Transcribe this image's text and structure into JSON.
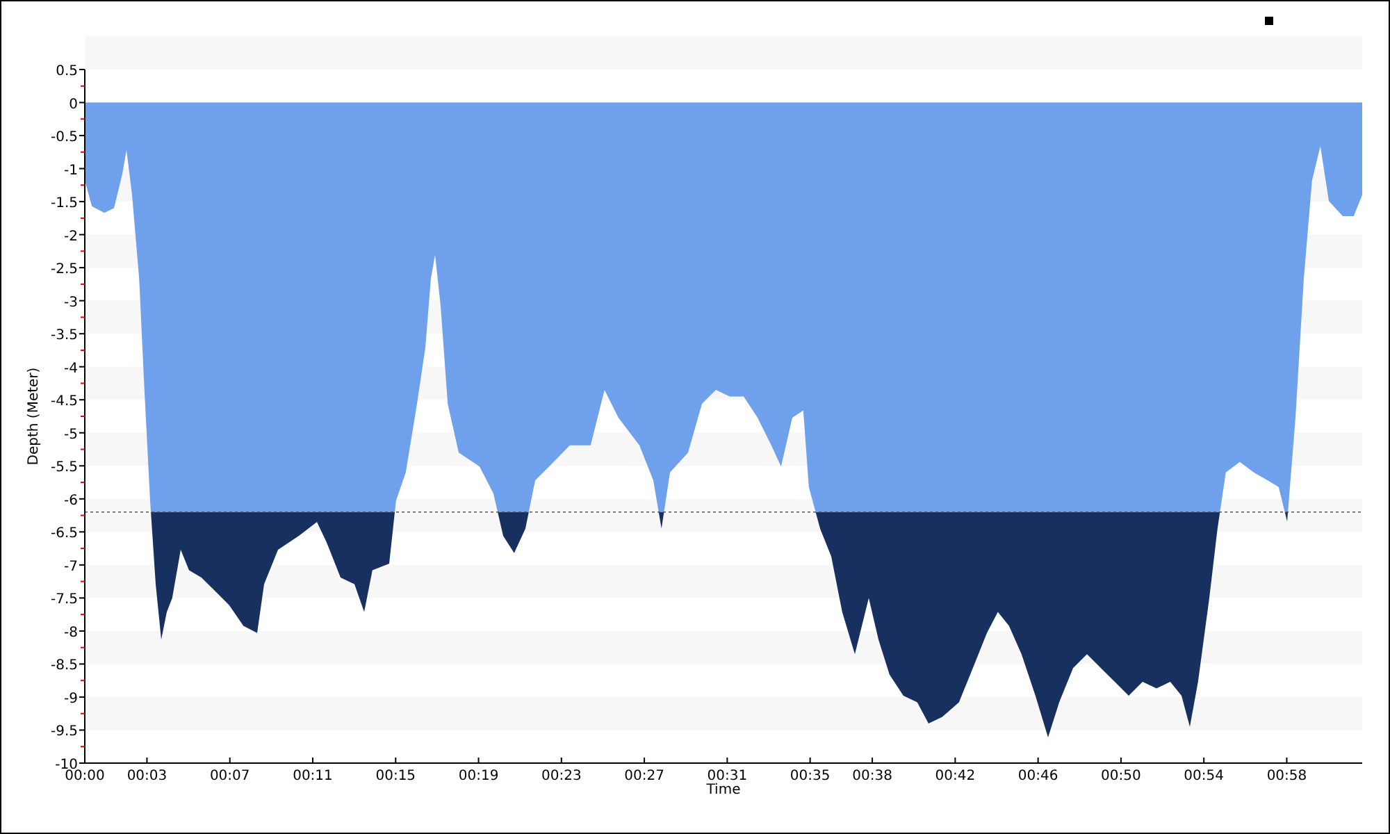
{
  "chart_data": {
    "type": "area",
    "xlabel": "Time",
    "ylabel": "Depth (Meter)",
    "x": [
      0,
      0.34,
      0.94,
      1.41,
      1.81,
      2.01,
      2.28,
      2.62,
      2.88,
      3.15,
      3.42,
      3.69,
      3.96,
      4.22,
      4.63,
      5.03,
      5.63,
      6.3,
      6.97,
      7.65,
      8.32,
      8.65,
      9.32,
      10.33,
      11.2,
      11.67,
      12.34,
      13.01,
      13.48,
      13.88,
      14.69,
      15.02,
      15.49,
      16.03,
      16.43,
      16.7,
      16.9,
      17.17,
      17.51,
      18.04,
      19.05,
      19.72,
      20.19,
      20.72,
      21.26,
      21.73,
      22.4,
      23.41,
      24.41,
      25.08,
      25.75,
      26.76,
      27.43,
      27.83,
      28.24,
      29.11,
      29.78,
      30.45,
      31.12,
      31.79,
      32.46,
      33.13,
      33.6,
      34.14,
      34.67,
      34.94,
      35.48,
      36.02,
      36.55,
      37.16,
      37.83,
      38.3,
      38.83,
      39.5,
      40.17,
      40.71,
      41.38,
      42.18,
      42.85,
      43.53,
      44.06,
      44.6,
      45.2,
      45.87,
      46.48,
      47.02,
      47.69,
      48.36,
      49.03,
      49.7,
      50.37,
      51.04,
      51.71,
      52.38,
      52.92,
      53.32,
      53.72,
      54.26,
      54.66,
      55.06,
      55.73,
      56.41,
      57.08,
      57.61,
      58.02,
      58.42,
      58.82,
      59.22,
      59.62,
      60.03,
      60.7,
      61.23,
      61.64
    ],
    "series": [
      {
        "color": "#6fa0ec",
        "values": [
          -1.18,
          -1.57,
          -1.67,
          -1.6,
          -1.08,
          -0.72,
          -1.4,
          -2.66,
          -4.35,
          -6.03,
          -7.29,
          -8.13,
          -7.71,
          -7.5,
          -6.77,
          -7.08,
          -7.19,
          -7.4,
          -7.61,
          -7.92,
          -8.03,
          -7.29,
          -6.77,
          -6.56,
          -6.35,
          -6.66,
          -7.19,
          -7.29,
          -7.71,
          -7.08,
          -6.98,
          -6.03,
          -5.6,
          -4.56,
          -3.71,
          -2.66,
          -2.3,
          -3.08,
          -4.56,
          -5.3,
          -5.51,
          -5.92,
          -6.56,
          -6.82,
          -6.45,
          -5.72,
          -5.51,
          -5.19,
          -5.19,
          -4.35,
          -4.77,
          -5.19,
          -5.72,
          -6.45,
          -5.6,
          -5.3,
          -4.56,
          -4.35,
          -4.45,
          -4.45,
          -4.77,
          -5.19,
          -5.51,
          -4.77,
          -4.66,
          -5.82,
          -6.45,
          -6.87,
          -7.71,
          -8.35,
          -7.5,
          -8.13,
          -8.66,
          -8.98,
          -9.08,
          -9.4,
          -9.3,
          -9.08,
          -8.56,
          -8.03,
          -7.71,
          -7.92,
          -8.35,
          -8.98,
          -9.61,
          -9.08,
          -8.56,
          -8.35,
          -8.56,
          -8.77,
          -8.98,
          -8.77,
          -8.87,
          -8.77,
          -8.98,
          -9.45,
          -8.77,
          -7.5,
          -6.45,
          -5.6,
          -5.44,
          -5.6,
          -5.72,
          -5.82,
          -6.34,
          -4.77,
          -2.66,
          -1.18,
          -0.66,
          -1.49,
          -1.72,
          -1.72,
          -1.4
        ]
      }
    ],
    "xlim": [
      0,
      61.64
    ],
    "ylim": [
      -10,
      0.5
    ],
    "xticks": [
      {
        "value": 0,
        "label": "00:00"
      },
      {
        "value": 3,
        "label": "00:03"
      },
      {
        "value": 7,
        "label": "00:07"
      },
      {
        "value": 11,
        "label": "00:11"
      },
      {
        "value": 15,
        "label": "00:15"
      },
      {
        "value": 19,
        "label": "00:19"
      },
      {
        "value": 23,
        "label": "00:23"
      },
      {
        "value": 27,
        "label": "00:27"
      },
      {
        "value": 31,
        "label": "00:31"
      },
      {
        "value": 35,
        "label": "00:35"
      },
      {
        "value": 38,
        "label": "00:38"
      },
      {
        "value": 42,
        "label": "00:42"
      },
      {
        "value": 46,
        "label": "00:46"
      },
      {
        "value": 50,
        "label": "00:50"
      },
      {
        "value": 54,
        "label": "00:54"
      },
      {
        "value": 58,
        "label": "00:58"
      }
    ],
    "yticks": [
      0.5,
      0,
      -0.5,
      -1,
      -1.5,
      -2,
      -2.5,
      -3,
      -3.5,
      -4,
      -4.5,
      -5,
      -5.5,
      -6,
      -6.5,
      -7,
      -7.5,
      -8,
      -8.5,
      -9,
      -9.5,
      -10
    ],
    "ref_lines": [
      {
        "axis": "y",
        "value": -6.2,
        "color": "#555555"
      }
    ]
  }
}
